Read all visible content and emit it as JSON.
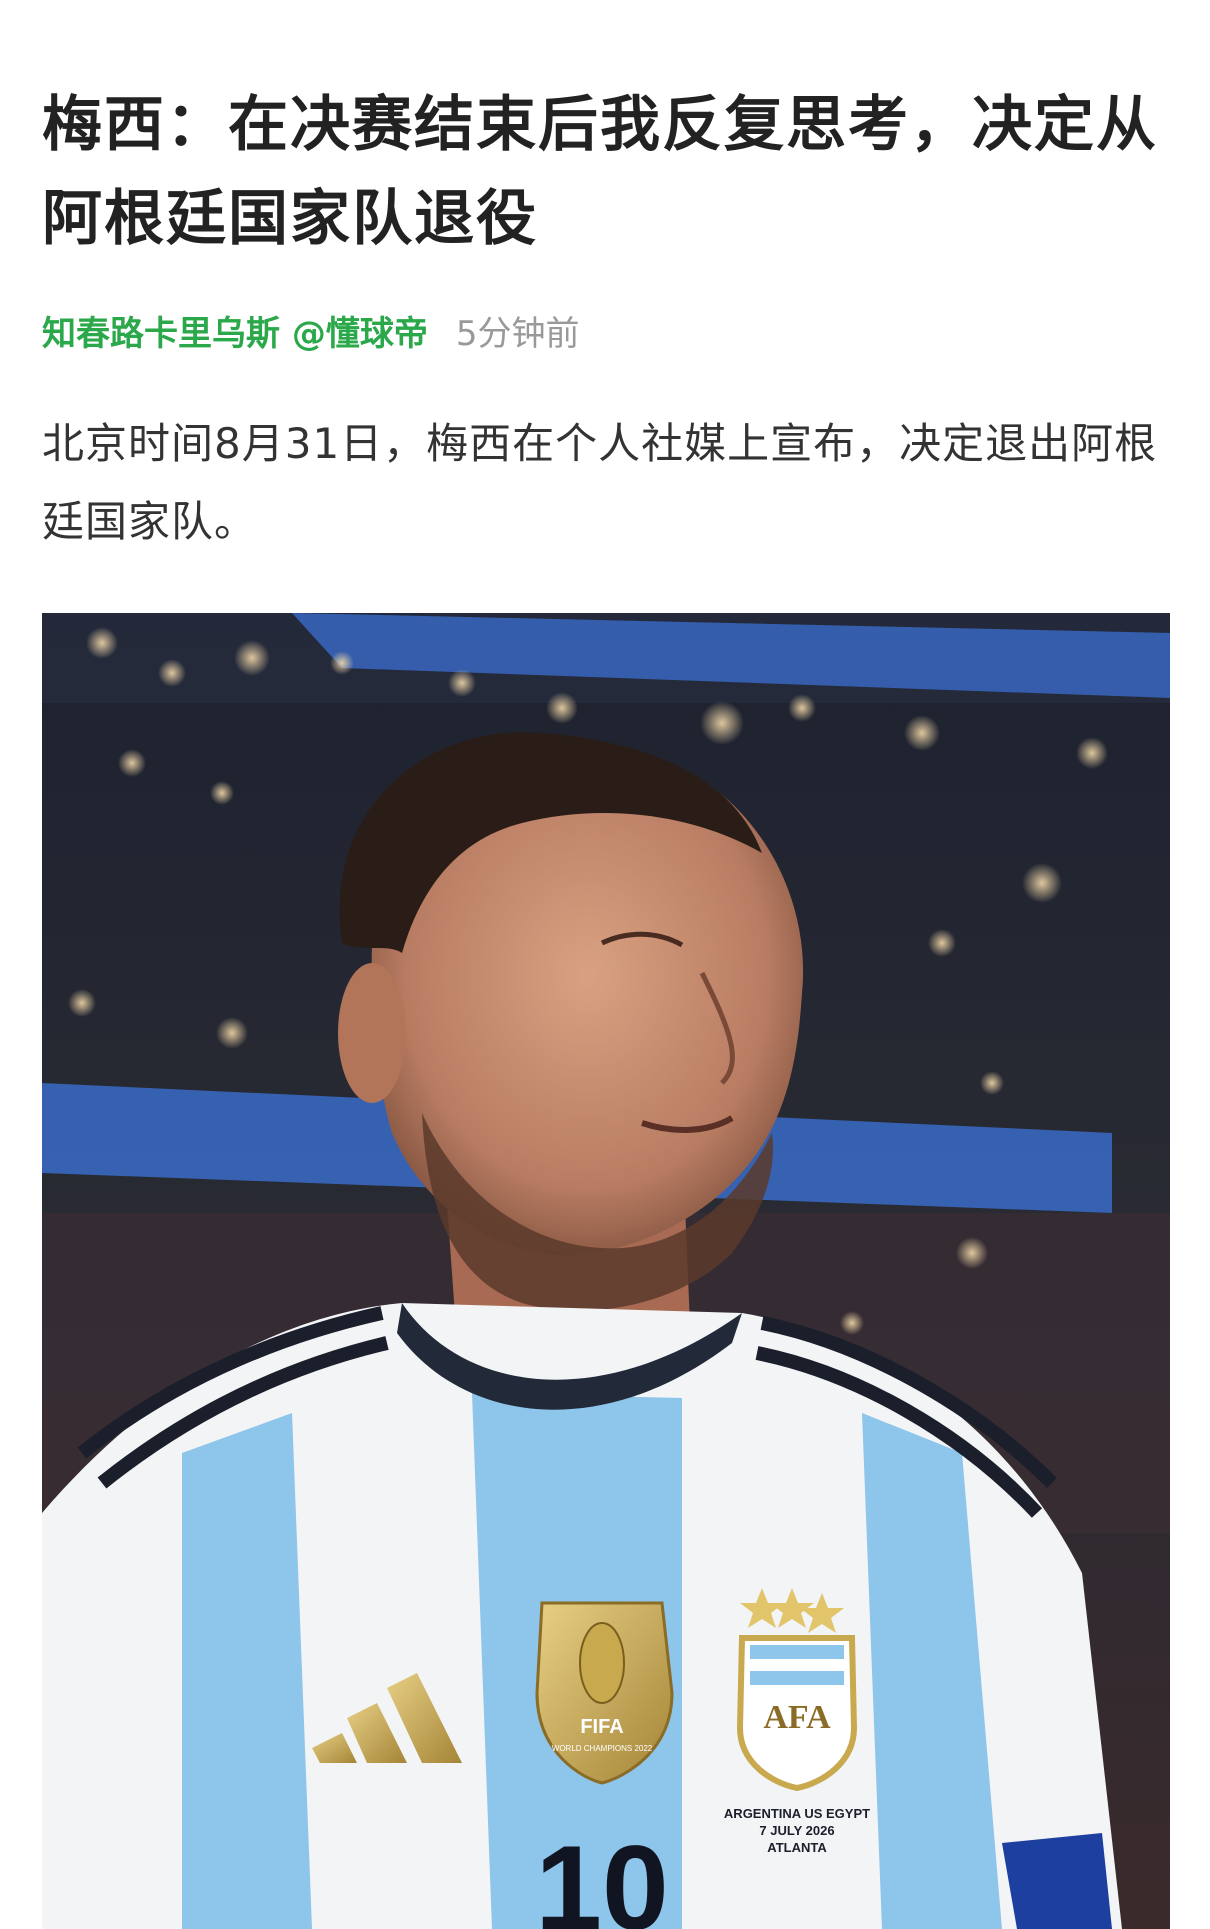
{
  "article": {
    "title": "梅西：在决赛结束后我反复思考，决定从阿根廷国家队退役",
    "author": "知春路卡里乌斯 @懂球帝",
    "time": "5分钟前",
    "paragraph": "北京时间8月31日，梅西在个人社媒上宣布，决定退出阿根廷国家队。"
  },
  "photo": {
    "jersey_badge_text": "FIFA",
    "jersey_badge_sub": "WORLD CHAMPIONS 2022",
    "crest_text": "AFA",
    "match_text_line1": "ARGENTINA US EGYPT",
    "match_text_line2": "7 JULY 2026",
    "match_text_line3": "ATLANTA",
    "shirt_number": "10"
  },
  "colors": {
    "title": "#222222",
    "author": "#2aa84a",
    "time": "#999999",
    "body": "#333333",
    "stadium_blue": "#3b6fd1",
    "jersey_blue": "#8ec5ea"
  }
}
